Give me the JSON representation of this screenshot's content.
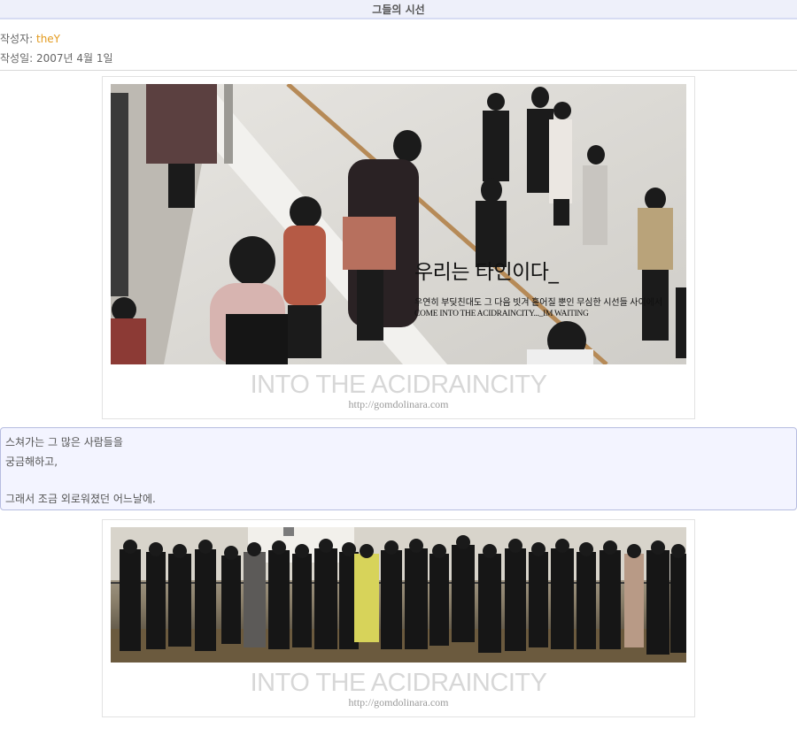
{
  "post": {
    "title": "그들의 시선",
    "author_label": "작성자: ",
    "author_name": "theY",
    "date_label": "작성일: ",
    "date_value": "2007년 4월 1일"
  },
  "photos": [
    {
      "overlay_title": "우리는 타인이다_",
      "overlay_sub1": "우연히 부딪친대도 그 다음 빗겨 흩어질 뿐인 무심한 시선들 사이에서",
      "overlay_sub2": "COME INTO THE ACIDRAINCITY..._IM WAITING",
      "watermark_main": "INTO THE ACIDRAINCITY",
      "watermark_url": "http://gomdolinara.com"
    },
    {
      "watermark_main": "INTO THE ACIDRAINCITY",
      "watermark_url": "http://gomdolinara.com"
    }
  ],
  "quote": {
    "line1": "스쳐가는 그 많은 사람들을",
    "line2": "궁금해하고,",
    "line3": "그래서 조금 외로워졌던 어느날에."
  },
  "colors": {
    "title_bar_bg": "#eef0fa",
    "author_accent": "#e39a1d",
    "quote_bg": "#f3f4ff",
    "quote_border": "#b7bde0"
  }
}
